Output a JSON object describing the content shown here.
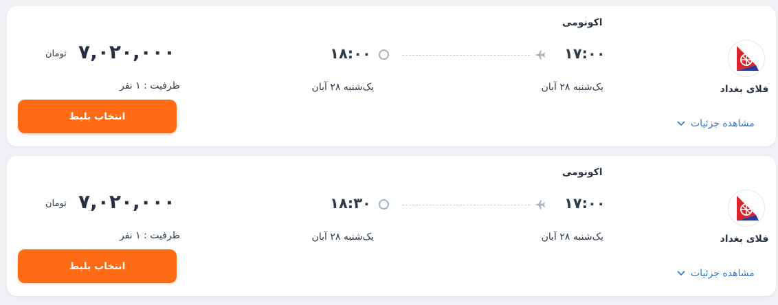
{
  "colors": {
    "accent": "#ff6a14",
    "link": "#2a76c8",
    "background": "#eef0f4",
    "card": "#ffffff"
  },
  "flights": [
    {
      "cabin": "اکونومی",
      "airline": "فلای بغداد",
      "departure_time": "۱۷:۰۰",
      "departure_date": "یک‌شنبه ۲۸ آبان",
      "arrival_time": "۱۸:۰۰",
      "arrival_date": "یک‌شنبه ۲۸ آبان",
      "price": "۷,۰۲۰,۰۰۰",
      "currency": "تومان",
      "capacity": "ظرفیت : ۱ نفر",
      "select_label": "انتخاب بلیط",
      "details_label": "مشاهده جزئیات"
    },
    {
      "cabin": "اکونومی",
      "airline": "فلای بغداد",
      "departure_time": "۱۷:۰۰",
      "departure_date": "یک‌شنبه ۲۸ آبان",
      "arrival_time": "۱۸:۳۰",
      "arrival_date": "یک‌شنبه ۲۸ آبان",
      "price": "۷,۰۲۰,۰۰۰",
      "currency": "تومان",
      "capacity": "ظرفیت : ۱ نفر",
      "select_label": "انتخاب بلیط",
      "details_label": "مشاهده جزئیات"
    }
  ]
}
